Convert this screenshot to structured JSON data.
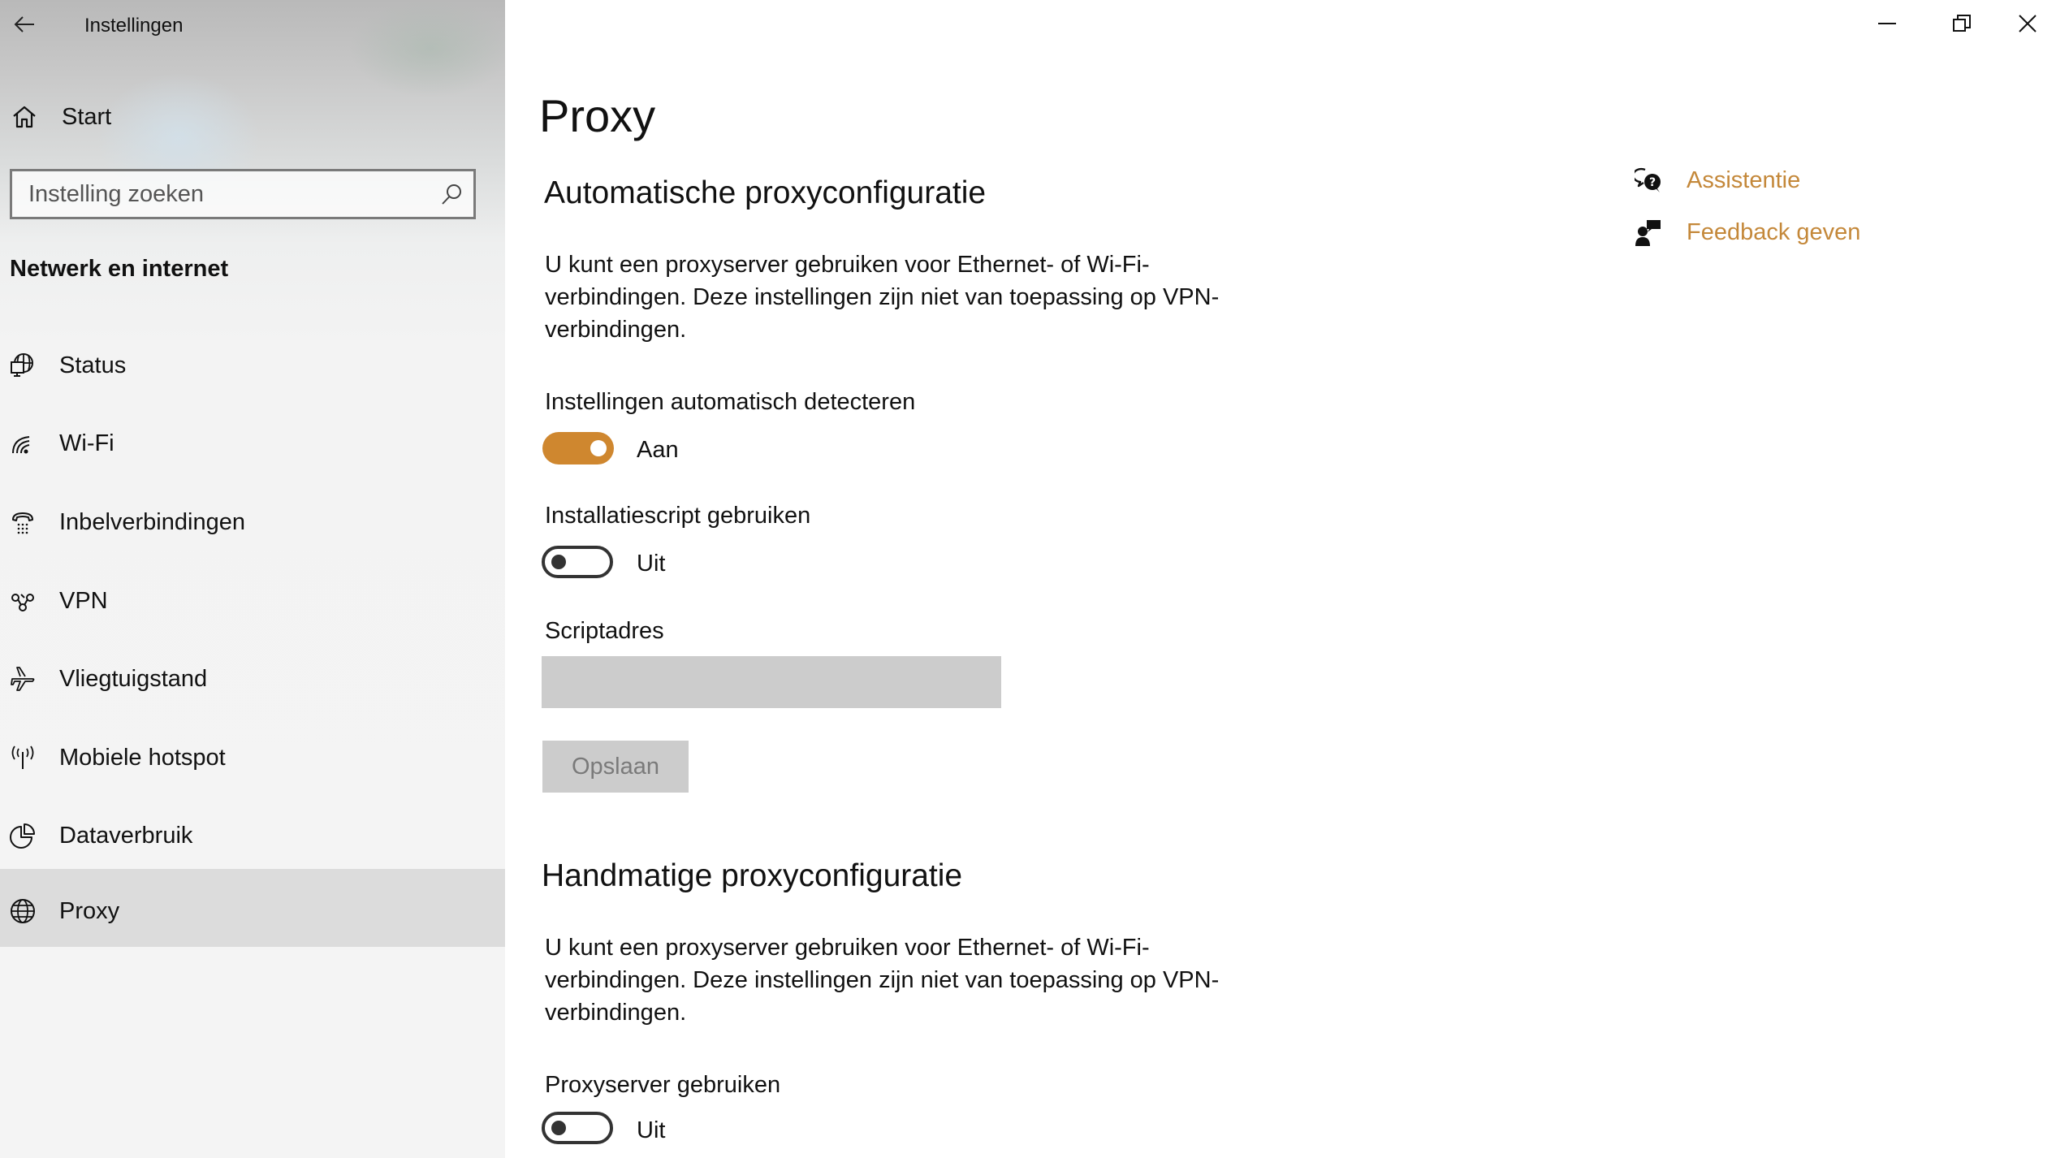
{
  "window": {
    "title": "Instellingen",
    "controls": {
      "minimize": "minimize-icon",
      "restore": "restore-icon",
      "close": "close-icon"
    }
  },
  "sidebar": {
    "home_label": "Start",
    "search": {
      "placeholder": "Instelling zoeken",
      "value": ""
    },
    "section_title": "Netwerk en internet",
    "items": [
      {
        "label": "Status",
        "icon": "network-status-icon",
        "selected": false
      },
      {
        "label": "Wi-Fi",
        "icon": "wifi-icon",
        "selected": false
      },
      {
        "label": "Inbelverbindingen",
        "icon": "dialup-phone-icon",
        "selected": false
      },
      {
        "label": "VPN",
        "icon": "vpn-icon",
        "selected": false
      },
      {
        "label": "Vliegtuigstand",
        "icon": "airplane-icon",
        "selected": false
      },
      {
        "label": "Mobiele hotspot",
        "icon": "hotspot-icon",
        "selected": false
      },
      {
        "label": "Dataverbruik",
        "icon": "data-usage-icon",
        "selected": false
      },
      {
        "label": "Proxy",
        "icon": "globe-icon",
        "selected": true
      }
    ]
  },
  "main": {
    "title": "Proxy",
    "auto": {
      "heading": "Automatische proxyconfiguratie",
      "description_lines": [
        "U kunt een proxyserver gebruiken voor Ethernet- of Wi-Fi-",
        "verbindingen. Deze instellingen zijn niet van toepassing op VPN-",
        "verbindingen."
      ],
      "detect": {
        "label": "Instellingen automatisch detecteren",
        "state": "Aan",
        "on": true
      },
      "script": {
        "label": "Installatiescript gebruiken",
        "state": "Uit",
        "on": false
      },
      "script_address": {
        "label": "Scriptadres",
        "value": "",
        "placeholder": ""
      },
      "save_label": "Opslaan"
    },
    "manual": {
      "heading": "Handmatige proxyconfiguratie",
      "description_lines": [
        "U kunt een proxyserver gebruiken voor Ethernet- of Wi-Fi-",
        "verbindingen. Deze instellingen zijn niet van toepassing op VPN-",
        "verbindingen."
      ],
      "use_proxy": {
        "label": "Proxyserver gebruiken",
        "state": "Uit",
        "on": false
      }
    }
  },
  "help_links": [
    {
      "label": "Assistentie",
      "icon": "help-chat-icon"
    },
    {
      "label": "Feedback geven",
      "icon": "feedback-icon"
    }
  ],
  "colors": {
    "accent": "#cf872f",
    "link": "#c4883a",
    "selected_nav": "#dcdcdc",
    "disabled_control": "#cccccc"
  }
}
